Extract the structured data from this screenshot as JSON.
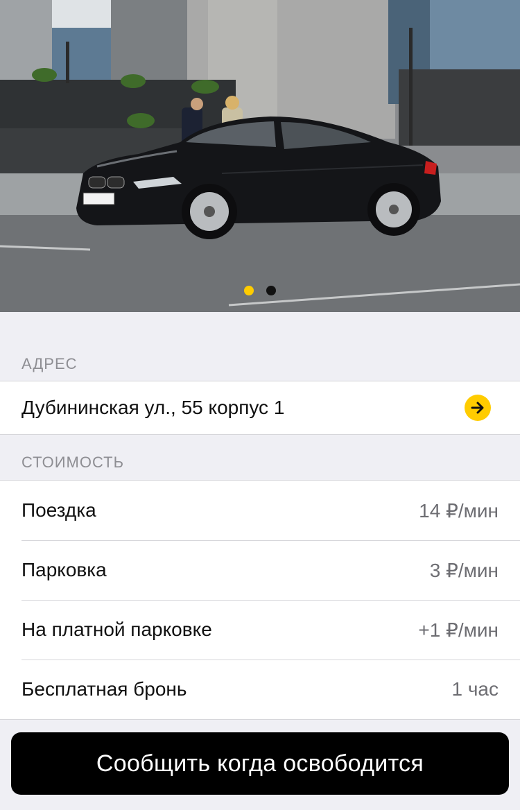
{
  "gallery": {
    "plate_text": "М523ТС799",
    "active_index": 1,
    "total": 2,
    "dot_active_color": "#ffcc00",
    "dot_inactive_color": "#111111"
  },
  "address": {
    "header": "АДРЕС",
    "value": "Дубининская ул., 55 корпус 1",
    "icon": "arrow-right-icon"
  },
  "cost": {
    "header": "СТОИМОСТЬ",
    "rows": [
      {
        "label": "Поездка",
        "value": "14 ₽/мин"
      },
      {
        "label": "Парковка",
        "value": "3 ₽/мин"
      },
      {
        "label": "На платной парковке",
        "value": "+1 ₽/мин"
      },
      {
        "label": "Бесплатная бронь",
        "value": "1 час"
      }
    ]
  },
  "action": {
    "label": "Сообщить когда освободится"
  },
  "colors": {
    "accent": "#ffcc00",
    "button_bg": "#000000",
    "background": "#efeff4"
  }
}
